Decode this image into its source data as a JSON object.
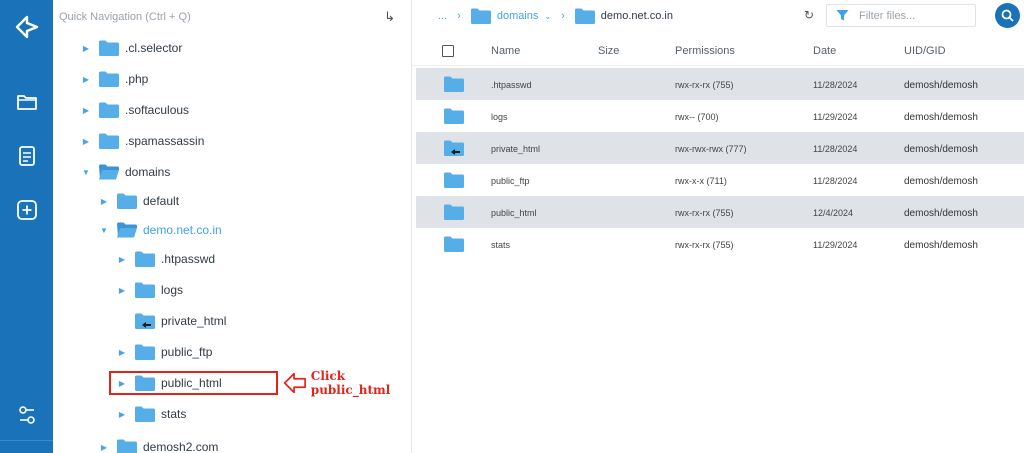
{
  "quick_nav": {
    "placeholder": "Quick Navigation (Ctrl + Q)",
    "enter_icon": "enter-arrow-icon"
  },
  "rail": {
    "items": [
      "logo-icon",
      "folder-icon",
      "document-icon",
      "add-square-icon",
      "settings-sliders-icon"
    ]
  },
  "tree": {
    "items": [
      {
        "label": ".cl.selector"
      },
      {
        "label": ".php"
      },
      {
        "label": ".softaculous"
      },
      {
        "label": ".spamassassin"
      },
      {
        "label": "domains"
      },
      {
        "label": "default"
      },
      {
        "label": "demo.net.co.in"
      },
      {
        "label": ".htpasswd"
      },
      {
        "label": "logs"
      },
      {
        "label": "private_html"
      },
      {
        "label": "public_ftp"
      },
      {
        "label": "public_html"
      },
      {
        "label": "stats"
      },
      {
        "label": "demosh2.com"
      }
    ]
  },
  "annotation": {
    "text": "Click public_html",
    "color": "#e0241a"
  },
  "breadcrumb": {
    "ellipsis": "...",
    "parent": "domains",
    "current": "demo.net.co.in"
  },
  "toolbar": {
    "filter_placeholder": "Filter files...",
    "refresh_icon": "refresh-icon",
    "search_icon": "search-icon"
  },
  "table": {
    "headers": {
      "name": "Name",
      "size": "Size",
      "permissions": "Permissions",
      "date": "Date",
      "uid": "UID/GID"
    },
    "rows": [
      {
        "name": ".htpasswd",
        "size": "",
        "permissions": "rwx-rx-rx (755)",
        "date": "11/28/2024",
        "uid": "demosh/demosh"
      },
      {
        "name": "logs",
        "size": "",
        "permissions": "rwx-- (700)",
        "date": "11/29/2024",
        "uid": "demosh/demosh"
      },
      {
        "name": "private_html",
        "size": "",
        "permissions": "rwx-rwx-rwx (777)",
        "date": "11/28/2024",
        "uid": "demosh/demosh"
      },
      {
        "name": "public_ftp",
        "size": "",
        "permissions": "rwx-x-x (711)",
        "date": "11/28/2024",
        "uid": "demosh/demosh"
      },
      {
        "name": "public_html",
        "size": "",
        "permissions": "rwx-rx-rx (755)",
        "date": "12/4/2024",
        "uid": "demosh/demosh"
      },
      {
        "name": "stats",
        "size": "",
        "permissions": "rwx-rx-rx (755)",
        "date": "11/29/2024",
        "uid": "demosh/demosh"
      }
    ]
  },
  "colors": {
    "rail": "#1a73b8",
    "accent": "#3fa2e6",
    "folder": "#55aee8",
    "row_alt": "#dfe3e8"
  }
}
